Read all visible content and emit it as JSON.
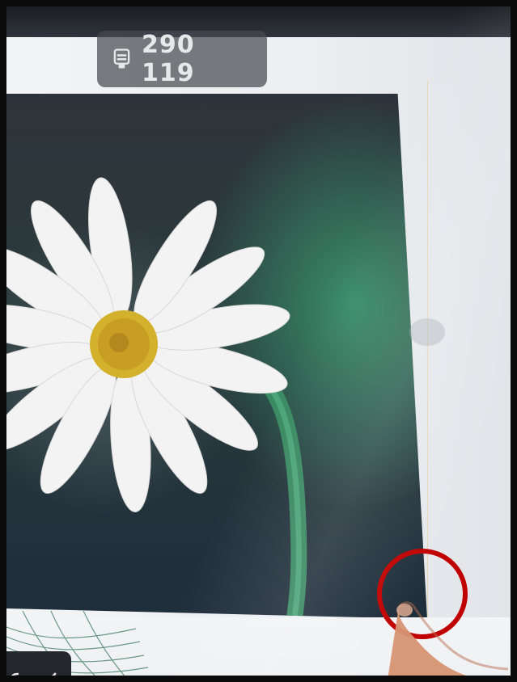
{
  "counter": {
    "value": "290 119",
    "icon": "stamp-icon"
  },
  "toolbar": {
    "undo_icon": "undo-icon",
    "confirm_icon": "checkmark-icon"
  },
  "photo": {
    "subject": "daisy",
    "accent_green": "#3eaa7a",
    "petal_white": "#f2f2f2",
    "center_yellow": "#d7b52b"
  },
  "annotation": {
    "highlight": "red-circle",
    "color": "#c00000"
  }
}
